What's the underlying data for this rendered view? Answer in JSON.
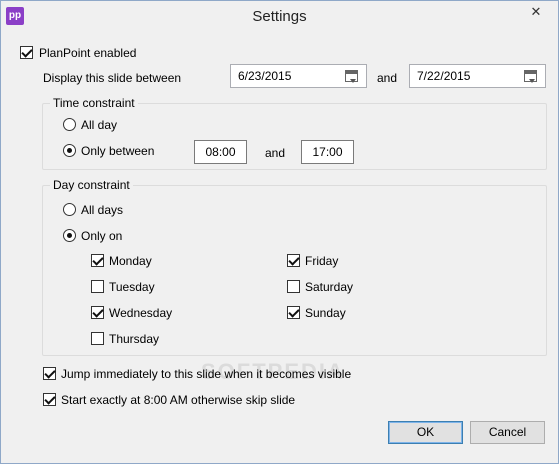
{
  "window": {
    "title": "Settings",
    "app_icon": "pp",
    "close_glyph": "✕"
  },
  "planpoint_enabled": {
    "label": "PlanPoint enabled",
    "checked": true
  },
  "display_range": {
    "label": "Display this slide between",
    "start_date": "6/23/2015",
    "and_label": "and",
    "end_date": "7/22/2015"
  },
  "time_constraint": {
    "title": "Time constraint",
    "all_day_label": "All day",
    "only_between_label": "Only between",
    "selected": "only_between",
    "start_time": "08:00",
    "and_label": "and",
    "end_time": "17:00"
  },
  "day_constraint": {
    "title": "Day constraint",
    "all_days_label": "All days",
    "only_on_label": "Only on",
    "selected": "only_on",
    "days": [
      {
        "label": "Monday",
        "checked": true
      },
      {
        "label": "Tuesday",
        "checked": false
      },
      {
        "label": "Wednesday",
        "checked": true
      },
      {
        "label": "Thursday",
        "checked": false
      },
      {
        "label": "Friday",
        "checked": true
      },
      {
        "label": "Saturday",
        "checked": false
      },
      {
        "label": "Sunday",
        "checked": true
      }
    ]
  },
  "jump_immediately": {
    "label": "Jump immediately to this slide when it becomes visible",
    "checked": true
  },
  "start_exactly": {
    "label": "Start exactly at 8:00 AM otherwise skip slide",
    "checked": true
  },
  "buttons": {
    "ok": "OK",
    "cancel": "Cancel"
  },
  "watermark": "SOFTPEDIA"
}
